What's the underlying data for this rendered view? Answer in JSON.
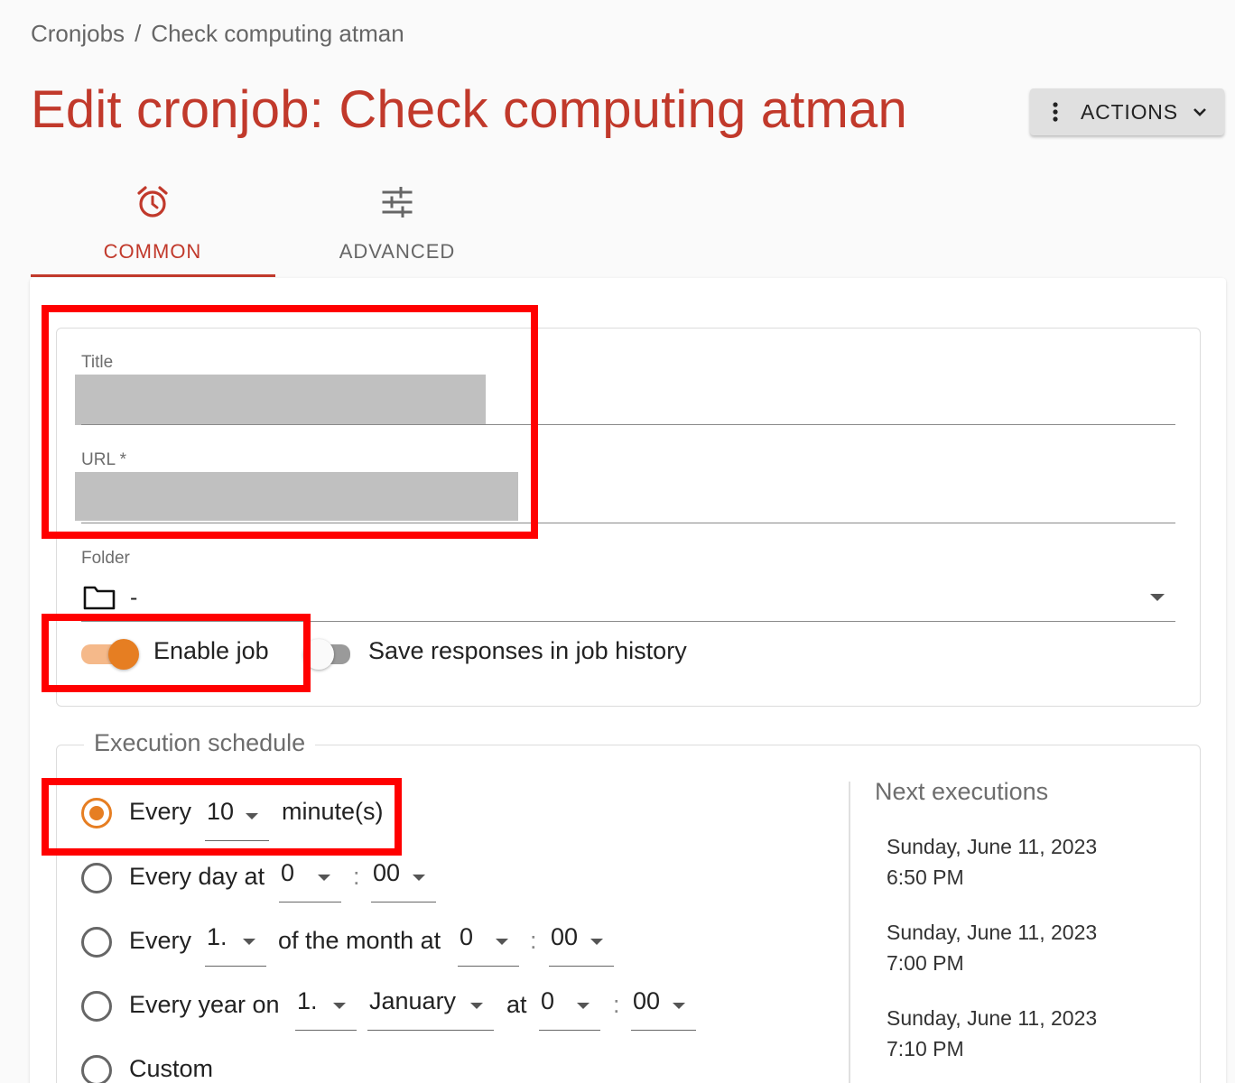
{
  "breadcrumb": {
    "parent": "Cronjobs",
    "separator": "/",
    "current": "Check computing atman"
  },
  "page": {
    "title": "Edit cronjob: Check computing atman"
  },
  "actions": {
    "label": "ACTIONS",
    "icon": "kebab-icon",
    "chevron": "chevron-down-icon"
  },
  "tabs": [
    {
      "label": "COMMON",
      "icon": "alarm-clock-icon",
      "active": true
    },
    {
      "label": "ADVANCED",
      "icon": "sliders-icon",
      "active": false
    }
  ],
  "form": {
    "title": {
      "label": "Title",
      "value": ""
    },
    "url": {
      "label": "URL *",
      "value": ""
    },
    "folder": {
      "label": "Folder",
      "value": "-",
      "icon": "folder-icon"
    },
    "enable_job": {
      "label": "Enable job",
      "on": true
    },
    "save_responses": {
      "label": "Save responses in job history",
      "on": false
    }
  },
  "schedule": {
    "legend": "Execution schedule",
    "every_minutes": {
      "prefix": "Every",
      "value": "10",
      "suffix": "minute(s)",
      "checked": true
    },
    "every_day": {
      "prefix": "Every day at",
      "hour": "0",
      "sep": ":",
      "minute": "00",
      "checked": false
    },
    "every_month": {
      "prefix": "Every",
      "day": "1.",
      "mid": "of the month at",
      "hour": "0",
      "sep": ":",
      "minute": "00",
      "checked": false
    },
    "every_year": {
      "prefix": "Every year on",
      "day": "1.",
      "month": "January",
      "at": "at",
      "hour": "0",
      "sep": ":",
      "minute": "00",
      "checked": false
    },
    "custom": {
      "label": "Custom",
      "checked": false
    }
  },
  "next_executions": {
    "title": "Next executions",
    "items": [
      {
        "date": "Sunday, June 11, 2023",
        "time": "6:50 PM"
      },
      {
        "date": "Sunday, June 11, 2023",
        "time": "7:00 PM"
      },
      {
        "date": "Sunday, June 11, 2023",
        "time": "7:10 PM"
      }
    ]
  },
  "colors": {
    "accent": "#c1392b",
    "toggle_on": "#e67e22",
    "highlight": "#ff0000"
  }
}
